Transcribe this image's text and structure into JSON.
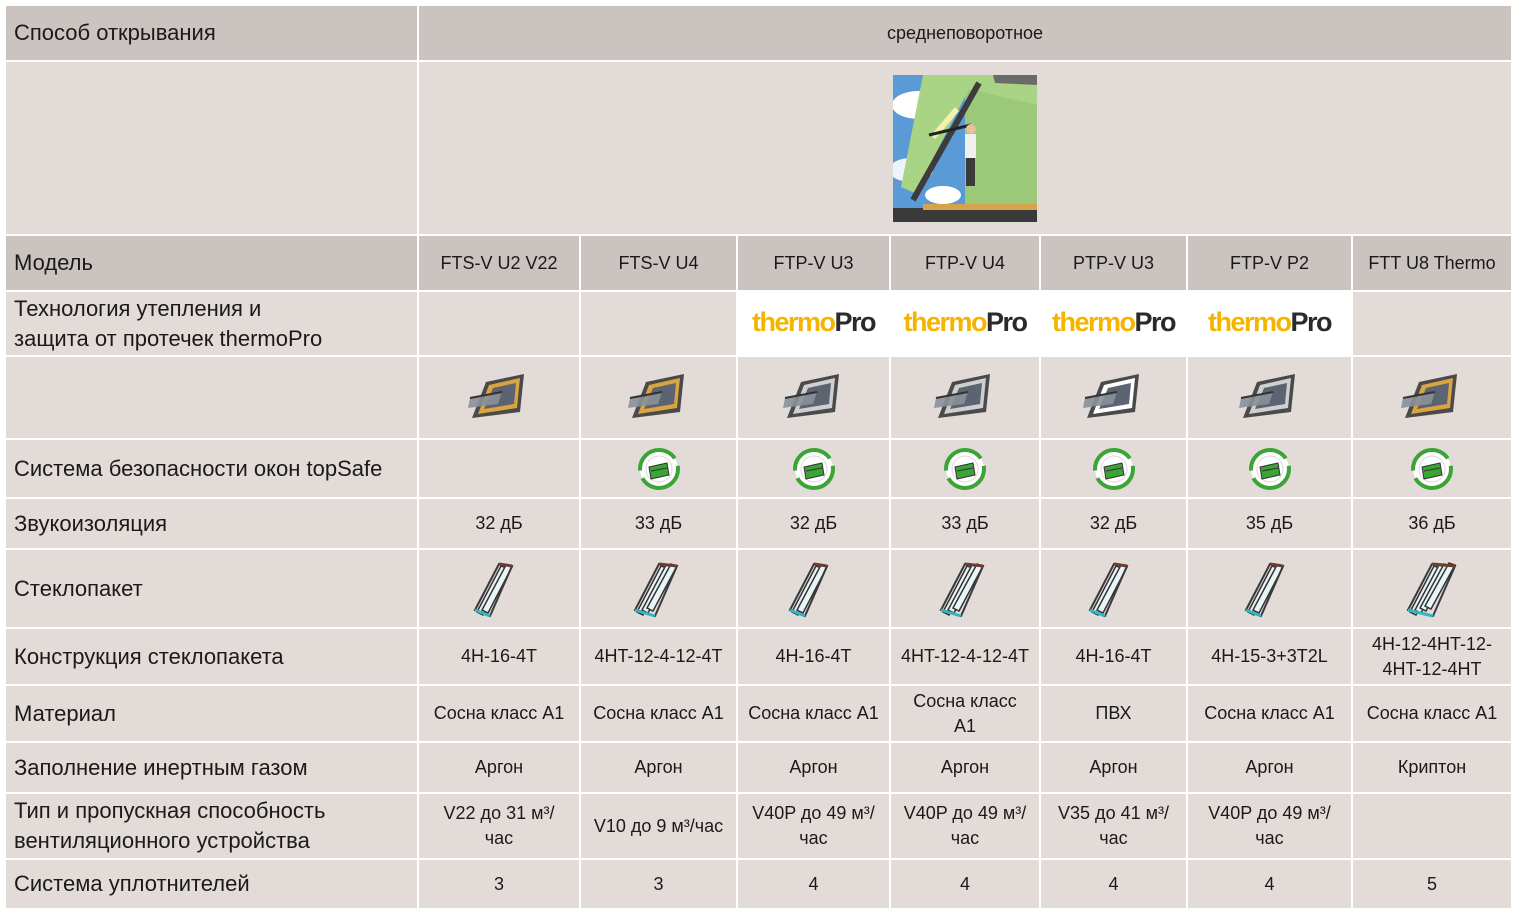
{
  "opening": {
    "label": "Способ открывания",
    "value": "среднеповоротное"
  },
  "illustration": {
    "icon": "pivot-window-room-illustration"
  },
  "model_row": {
    "label": "Модель",
    "values": [
      "FTS-V U2 V22",
      "FTS-V U4",
      "FTP-V U3",
      "FTP-V U4",
      "PTP-V U3",
      "FTP-V P2",
      "FTT U8 Thermo"
    ]
  },
  "thermo_row": {
    "label_line1": "Технология утепления и",
    "label_line2": "защита от протечек thermoPro",
    "logo_part1": "thermo",
    "logo_part2": "Pro",
    "logo_color": "#f5b400",
    "has_logo": [
      false,
      false,
      true,
      true,
      true,
      true,
      false
    ]
  },
  "window_row": {
    "icon": "roof-window-icon",
    "frame_colors": [
      "#d9a441",
      "#d9a441",
      "#cfcfcf",
      "#cfcfcf",
      "#ffffff",
      "#cfcfcf",
      "#d9a441"
    ]
  },
  "topsafe_row": {
    "label": "Система безопасности окон topSafe",
    "icon": "topsafe-badge-icon",
    "badge_color": "#3aa535",
    "has_badge": [
      false,
      true,
      true,
      true,
      true,
      true,
      true
    ]
  },
  "sound_row": {
    "label": "Звукоизоляция",
    "values": [
      "32 дБ",
      "33 дБ",
      "32 дБ",
      "33 дБ",
      "32 дБ",
      "35 дБ",
      "36 дБ"
    ]
  },
  "glass_row": {
    "label": "Стеклопакет",
    "icon": "glazing-unit-icon",
    "panes": [
      2,
      3,
      2,
      3,
      2,
      2,
      4
    ],
    "glass_color": "#35b4c2"
  },
  "construction_row": {
    "label": "Конструкция стеклопакета",
    "values": [
      "4H-16-4T",
      "4HT-12-4-12-4T",
      "4H-16-4T",
      "4HT-12-4-12-4T",
      "4H-16-4T",
      "4H-15-3+3T2L",
      "4H-12-4HT-12-4HT-12-4HT"
    ]
  },
  "material_row": {
    "label": "Материал",
    "values": [
      "Сосна класс А1",
      "Сосна класс А1",
      "Сосна класс А1",
      "Сосна класс А1",
      "ПВХ",
      "Сосна класс А1",
      "Сосна класс А1"
    ]
  },
  "gas_row": {
    "label": "Заполнение инертным газом",
    "values": [
      "Аргон",
      "Аргон",
      "Аргон",
      "Аргон",
      "Аргон",
      "Аргон",
      "Криптон"
    ]
  },
  "vent_row": {
    "label_line1": "Тип и пропускная способность",
    "label_line2": "вентиляционного устройства",
    "values": [
      "V22 до 31 м³/час",
      "V10 до 9 м³/час",
      "V40P до 49 м³/час",
      "V40P до 49 м³/час",
      "V35 до 41 м³/час",
      "V40P до 49 м³/час",
      ""
    ]
  },
  "seal_row": {
    "label": "Система уплотнителей",
    "values": [
      "3",
      "3",
      "4",
      "4",
      "4",
      "4",
      "5"
    ]
  },
  "colors": {
    "header_bg": "#cbc3bf",
    "row_bg": "#e2dbd7"
  }
}
